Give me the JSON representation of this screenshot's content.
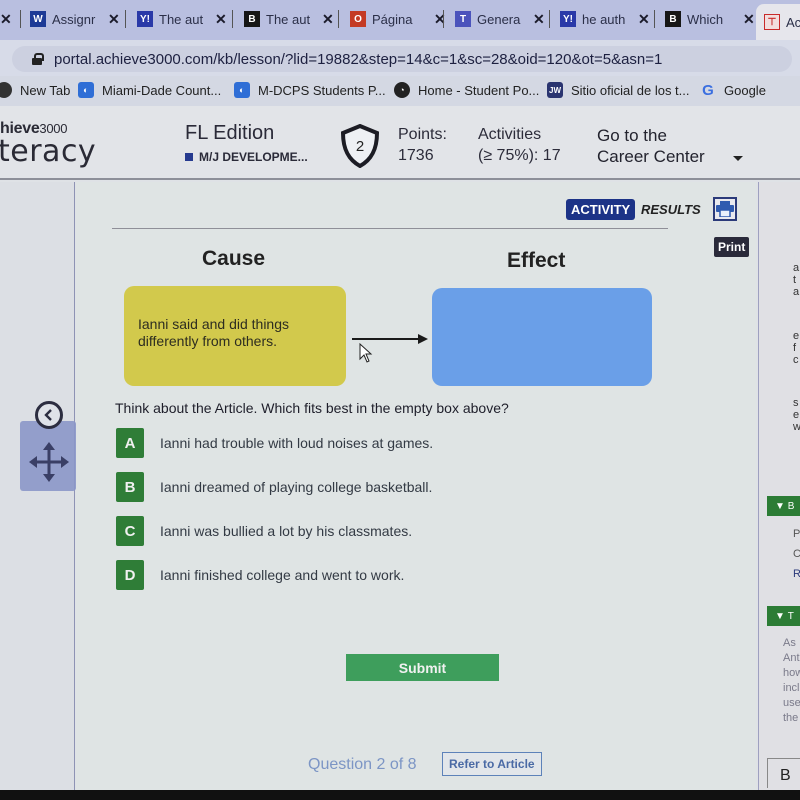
{
  "browser": {
    "tabs": [
      {
        "icon": "word-icon",
        "glyph": "W",
        "color": "#1d3a96",
        "title": "Assignr"
      },
      {
        "icon": "yahoo-icon",
        "glyph": "Y!",
        "color": "#2a39a8",
        "title": "The aut"
      },
      {
        "icon": "brainly-icon",
        "glyph": "B",
        "color": "#161616",
        "title": "The aut"
      },
      {
        "icon": "office-icon",
        "glyph": "O",
        "color": "#c43a24",
        "title": "Página"
      },
      {
        "icon": "teams-icon",
        "glyph": "T",
        "color": "#4b53bc",
        "title": "Genera"
      },
      {
        "icon": "yahoo-icon",
        "glyph": "Y!",
        "color": "#2a39a8",
        "title": "he auth"
      },
      {
        "icon": "brainly-icon",
        "glyph": "B",
        "color": "#161616",
        "title": "Which"
      },
      {
        "icon": "achieve-icon",
        "glyph": "A",
        "color": "#c82a2a",
        "title": "Ac"
      }
    ],
    "close_glyph": "✕",
    "url": "portal.achieve3000.com/kb/lesson/?lid=19882&step=14&c=1&sc=28&oid=120&ot=5&asn=1",
    "bookmarks": [
      {
        "label": "New Tab",
        "icon": "globe-icon"
      },
      {
        "label": "Miami-Dade Count...",
        "icon": "mdcps-icon"
      },
      {
        "label": "M-DCPS Students P...",
        "icon": "mdcps-icon"
      },
      {
        "label": "Home - Student Po...",
        "icon": "portal-icon"
      },
      {
        "label": "Sitio oficial de los t...",
        "icon": "jw-icon",
        "glyph": "JW"
      },
      {
        "label": "Google",
        "icon": "google-icon",
        "glyph": "G"
      }
    ]
  },
  "header": {
    "logo_top": "hieve",
    "logo_top_suffix": "3000",
    "logo_main": "teracy",
    "edition": "FL Edition",
    "course": "M/J DEVELOPME...",
    "level_badge": "2",
    "points_label": "Points:",
    "points_value": "1736",
    "activities_label": "Activities",
    "activities_value": "(≥ 75%): 17",
    "career_line1": "Go to the",
    "career_line2": "Career Center"
  },
  "activity": {
    "tab_activity": "ACTIVITY",
    "tab_results": "RESULTS",
    "print_tooltip": "Print",
    "cause_heading": "Cause",
    "effect_heading": "Effect",
    "cause_text": "Ianni said and did things differently from others.",
    "effect_text": "",
    "question": "Think about the Article. Which fits best in the empty box above?",
    "options": [
      {
        "letter": "A",
        "text": "Ianni had trouble with loud noises at games."
      },
      {
        "letter": "B",
        "text": "Ianni dreamed of playing college basketball."
      },
      {
        "letter": "C",
        "text": "Ianni was bullied a lot by his classmates."
      },
      {
        "letter": "D",
        "text": "Ianni finished college and went to work."
      }
    ],
    "submit_label": "Submit",
    "question_counter": "Question 2 of 8",
    "refer_label": "Refer to Article"
  },
  "right_panel": {
    "section1_header": "B",
    "section1_items": [
      "P",
      "C",
      "R"
    ],
    "section2_header": "T",
    "section2_lines": [
      "As",
      "Ant",
      "how",
      "incl",
      "use",
      "the"
    ],
    "upper_fragments": [
      "a",
      "t",
      "a",
      "e",
      "f",
      "c",
      "s",
      "e",
      "w"
    ],
    "bottom_fragment": "B"
  },
  "colors": {
    "brand_blue": "#1c3387",
    "option_green": "#2f7d37",
    "submit_green": "#3e9e5c",
    "cause_yellow": "#d2c94c",
    "effect_blue": "#6a9fe8"
  }
}
